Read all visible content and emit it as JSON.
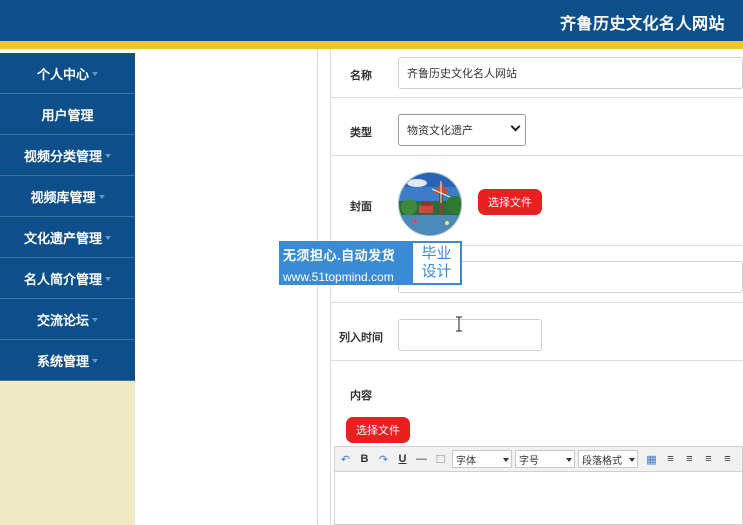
{
  "header": {
    "title": "齐鲁历史文化名人网站"
  },
  "sidebar": {
    "items": [
      {
        "label": "个人中心"
      },
      {
        "label": "用户管理"
      },
      {
        "label": "视频分类管理"
      },
      {
        "label": "视频库管理"
      },
      {
        "label": "文化遗产管理"
      },
      {
        "label": "名人简介管理"
      },
      {
        "label": "交流论坛"
      },
      {
        "label": "系统管理"
      }
    ]
  },
  "form": {
    "name_label": "名称",
    "name_value": "齐鲁历史文化名人网站",
    "type_label": "类型",
    "type_value": "物资文化遗产",
    "cover_label": "封面",
    "cover_button": "选择文件",
    "date_label": "列入时间",
    "date_value": "",
    "content_label": "内容",
    "content_button": "选择文件"
  },
  "editor_toolbar": {
    "bold": "B",
    "underline": "U",
    "font": "字体",
    "size": "字号",
    "paragraph": "段落格式"
  },
  "watermark": {
    "line1": "无须担心.自动发货",
    "line2": "www.51topmind.com",
    "badge_line1": "毕业",
    "badge_line2": "设计"
  },
  "colors": {
    "header_blue": "#0c4f8a",
    "accent_yellow": "#f1c232",
    "button_red": "#ea1f1f",
    "sidebar_bg": "#efe9c5"
  }
}
